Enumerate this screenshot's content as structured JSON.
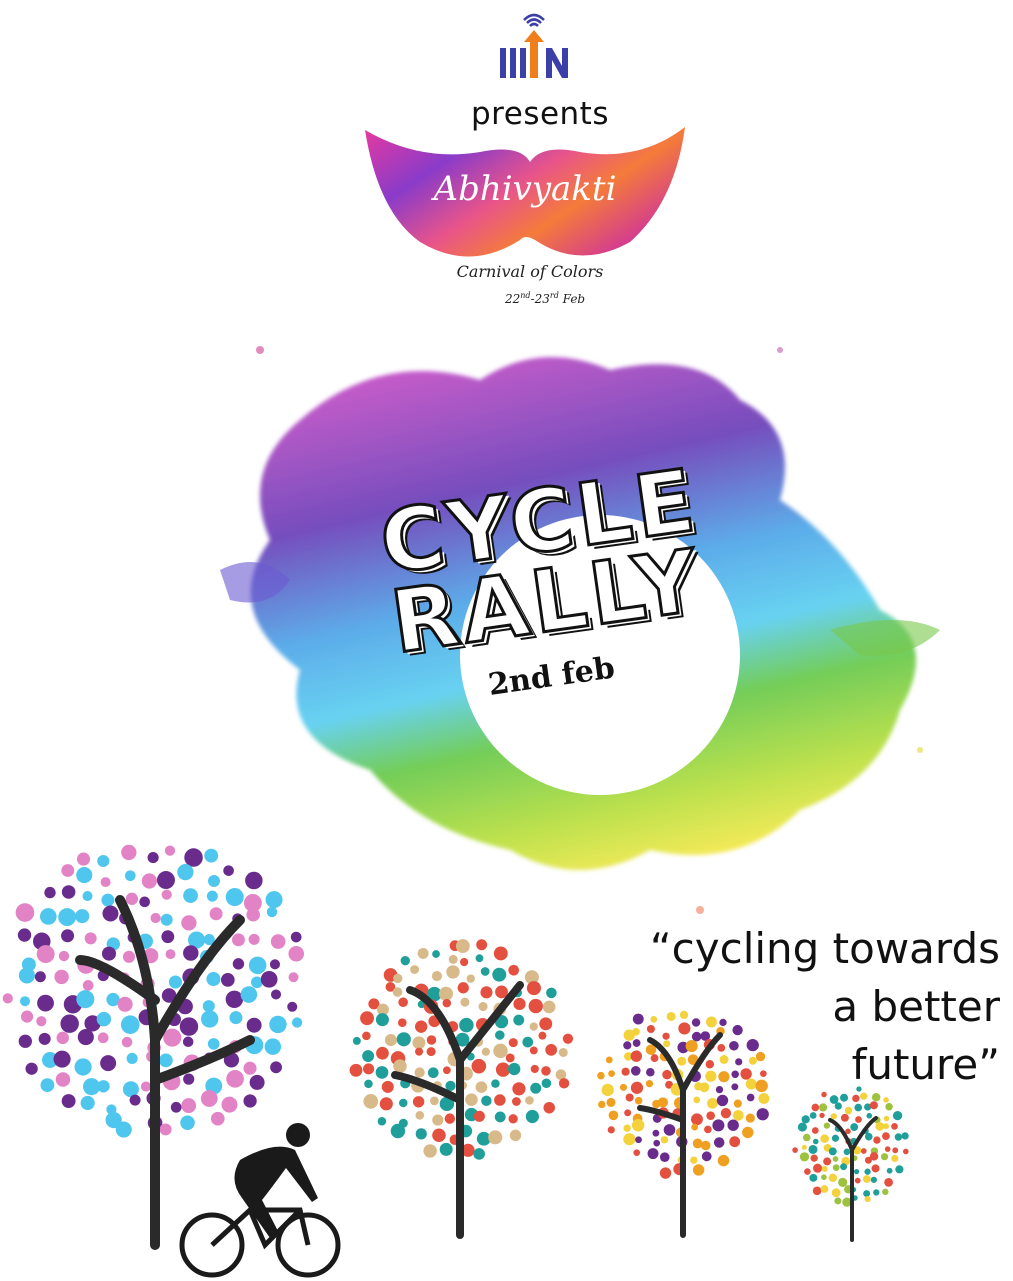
{
  "header": {
    "logo_name": "iiit-logo",
    "presents": "presents"
  },
  "event": {
    "name": "Abhivyakti",
    "tagline": "Carnival of Colors",
    "date_start": "22",
    "date_start_sup": "nd",
    "date_sep": "-23",
    "date_end_sup": "rd",
    "date_month": " Feb"
  },
  "rally": {
    "line1": "CYCLE",
    "line2": "RALLY",
    "date": "2nd feb"
  },
  "quote": {
    "line1": "“cycling towards",
    "line2": "a better",
    "line3": "future”"
  },
  "colors": {
    "logo_blue": "#3b3fa8",
    "logo_orange": "#f07f1b",
    "tree_purple": "#6a2c8c",
    "tree_pink": "#e283c6",
    "tree_cyan": "#4fc6ee",
    "tree_red": "#e3503f",
    "tree_teal": "#1f9e9a",
    "tree_tan": "#d8b98a",
    "tree_orange": "#f0a020",
    "tree_yellow": "#f3d23c",
    "tree_green": "#9cc23f"
  }
}
